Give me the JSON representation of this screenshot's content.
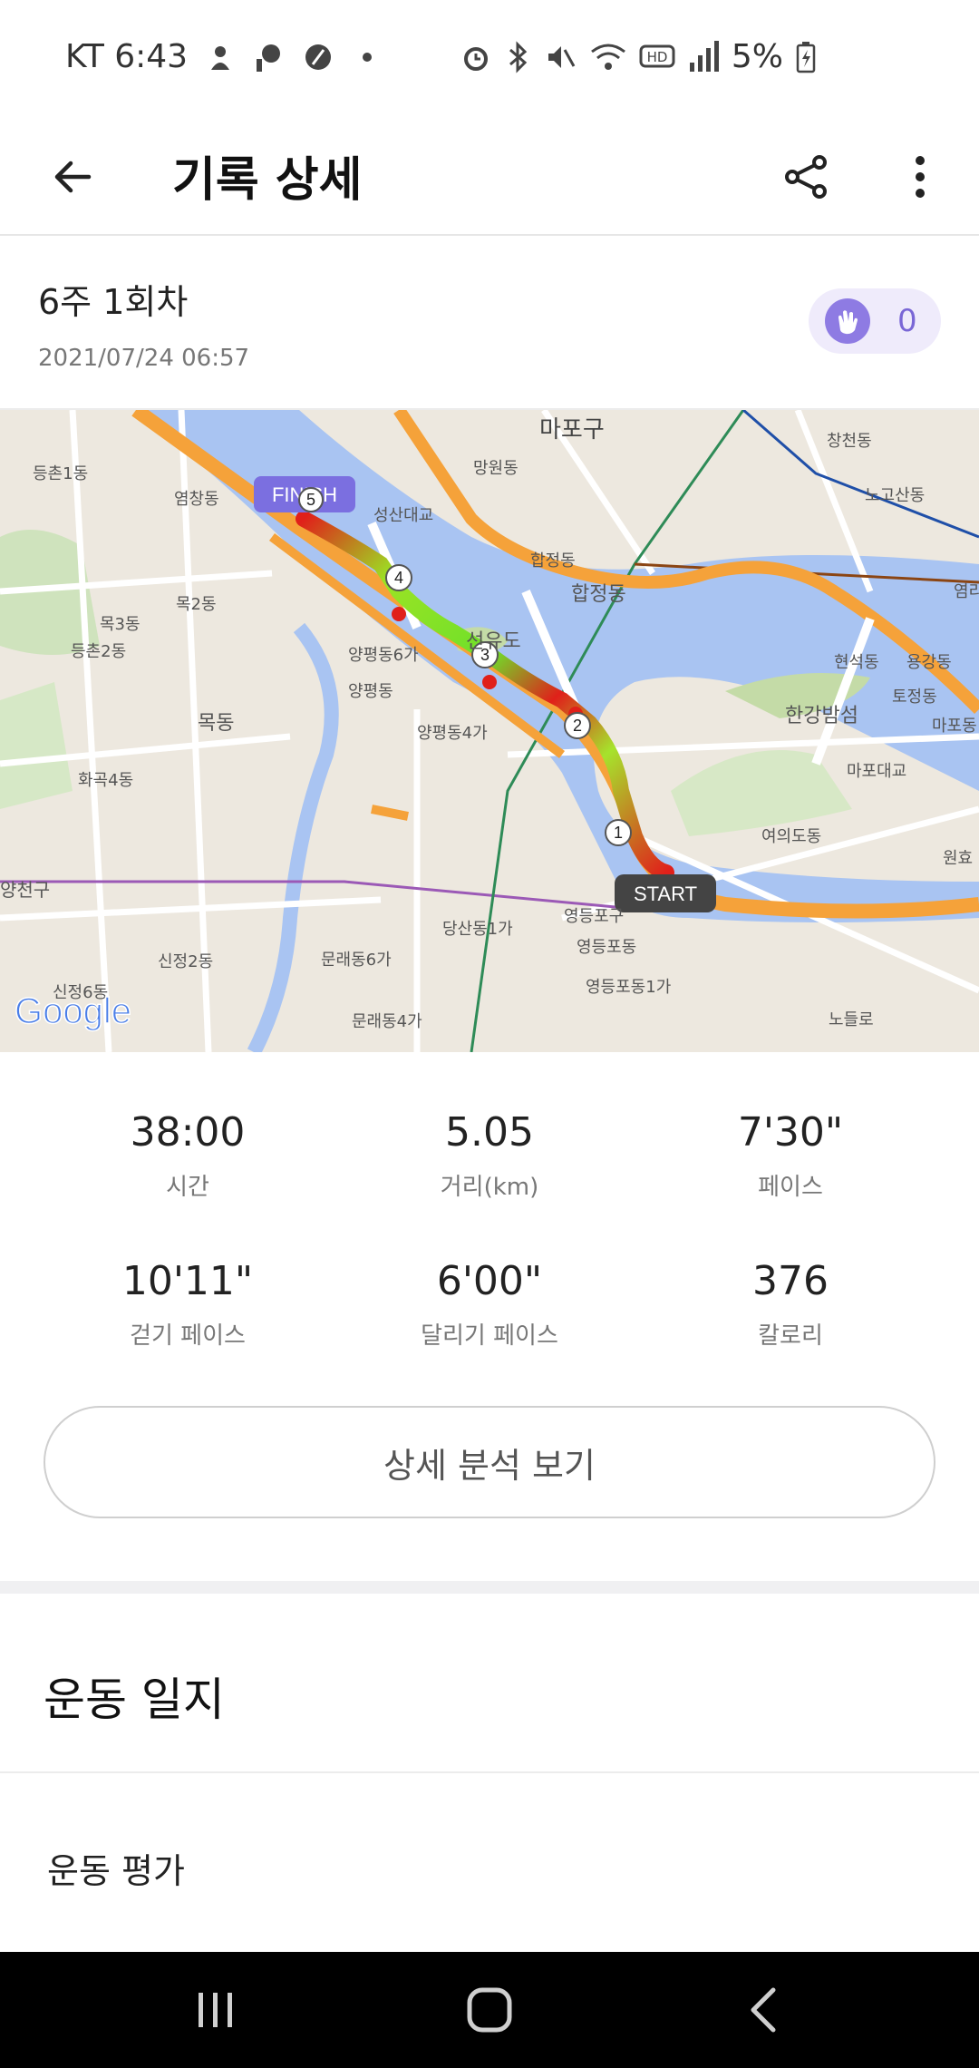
{
  "status_bar": {
    "carrier_time": "KT 6:43",
    "battery": "5%"
  },
  "app_bar": {
    "title": "기록 상세"
  },
  "record": {
    "title": "6주 1회차",
    "datetime": "2021/07/24 06:57",
    "clap_count": "0"
  },
  "map": {
    "google_label": "Google",
    "start_label": "START",
    "finish_label": "FINISH",
    "markers": [
      "1",
      "2",
      "3",
      "4",
      "5"
    ],
    "place_labels": [
      "마포구",
      "창천동",
      "노고산동",
      "등촌1동",
      "염창동",
      "망원동",
      "성산대교",
      "합정동",
      "합정동",
      "목2동",
      "목3동",
      "등촌2동",
      "양평동6가",
      "선유도",
      "현석동",
      "용강동",
      "토정동",
      "양평동",
      "한강밤섬",
      "마포동",
      "목동",
      "양평동4가",
      "마포대교",
      "화곡4동",
      "여의도동",
      "원효",
      "양천구",
      "영등포구",
      "당산동1가",
      "영등포동",
      "신정2동",
      "문래동6가",
      "영등포동1가",
      "신정6동",
      "문래동4가",
      "노들로",
      "염리"
    ]
  },
  "stats": [
    {
      "value": "38:00",
      "label": "시간"
    },
    {
      "value": "5.05",
      "label": "거리(km)"
    },
    {
      "value": "7'30\"",
      "label": "페이스"
    },
    {
      "value": "10'11\"",
      "label": "걷기 페이스"
    },
    {
      "value": "6'00\"",
      "label": "달리기 페이스"
    },
    {
      "value": "376",
      "label": "칼로리"
    }
  ],
  "detail_button": "상세 분석 보기",
  "journal": {
    "title": "운동 일지",
    "evaluation_label": "운동 평가"
  },
  "colors": {
    "accent": "#7a67d6",
    "river": "#a9c4f2",
    "road": "#f5a23a",
    "pace_fast": "#6ee02a",
    "pace_slow": "#e0201a"
  }
}
